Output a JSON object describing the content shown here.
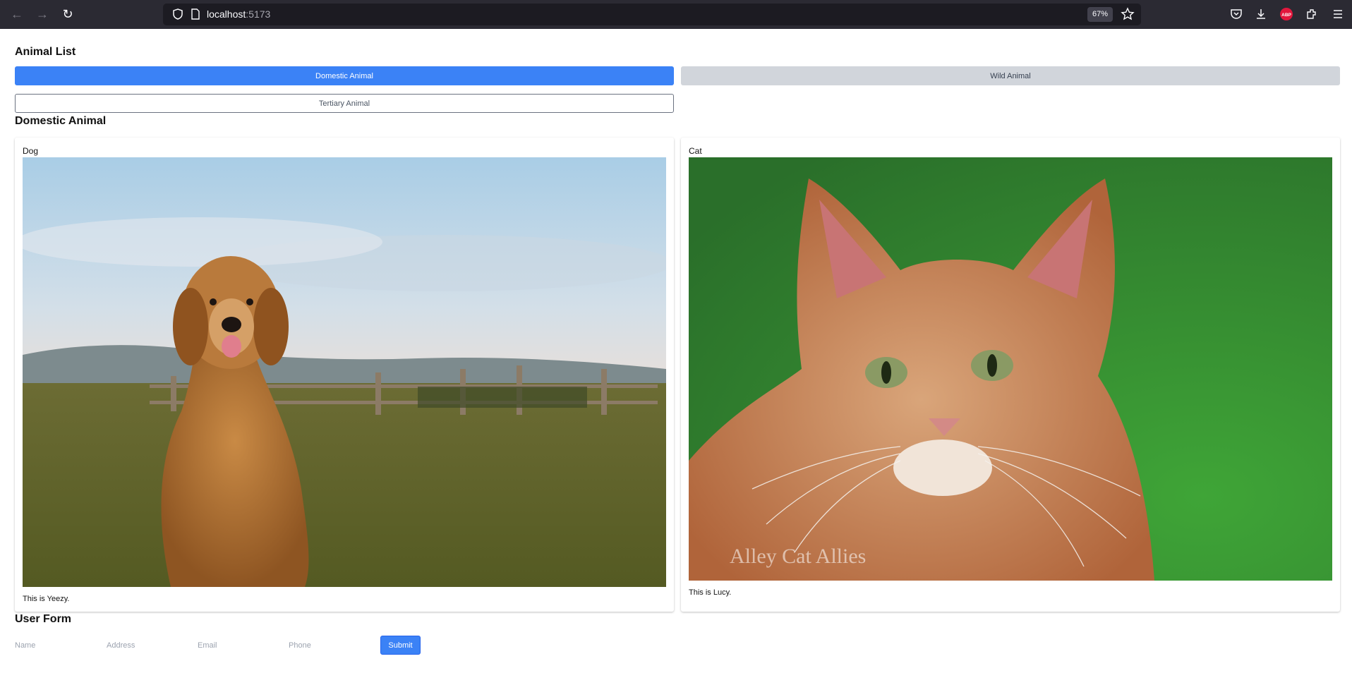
{
  "browser": {
    "url_host": "localhost",
    "url_port": ":5173",
    "zoom": "67%"
  },
  "page": {
    "list_title": "Animal List",
    "tabs": {
      "domestic": "Domestic Animal",
      "wild": "Wild Animal",
      "tertiary": "Tertiary Animal"
    },
    "section_title": "Domestic Animal",
    "cards": [
      {
        "title": "Dog",
        "description": "This is Yeezy."
      },
      {
        "title": "Cat",
        "description": "This is Lucy.",
        "watermark": "Alley Cat Allies"
      }
    ],
    "form": {
      "title": "User Form",
      "name_placeholder": "Name",
      "address_placeholder": "Address",
      "email_placeholder": "Email",
      "phone_placeholder": "Phone",
      "submit_label": "Submit"
    }
  },
  "colors": {
    "primary": "#3b82f6",
    "secondary": "#d1d5db",
    "chrome_bg": "#2b2a33"
  }
}
